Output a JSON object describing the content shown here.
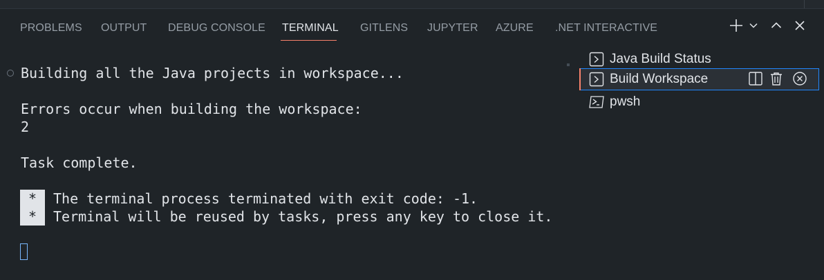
{
  "panel": {
    "tabs": [
      {
        "label": "PROBLEMS"
      },
      {
        "label": "OUTPUT"
      },
      {
        "label": "DEBUG CONSOLE"
      },
      {
        "label": "TERMINAL",
        "active": true
      },
      {
        "label": "GITLENS"
      },
      {
        "label": "JUPYTER"
      },
      {
        "label": "AZURE"
      },
      {
        "label": ".NET INTERACTIVE"
      }
    ],
    "actions": {
      "new_terminal": "plus-icon",
      "dropdown": "chevron-down-icon",
      "maximize": "chevron-up-icon",
      "close": "close-icon"
    }
  },
  "terminal": {
    "lines": [
      "Building all the Java projects in workspace...",
      "Errors occur when building the workspace:",
      "2",
      "Task complete.",
      "The terminal process terminated with exit code: -1.",
      "Terminal will be reused by tasks, press any key to close it."
    ],
    "star": "*"
  },
  "terminal_list": {
    "items": [
      {
        "label": "Java Build Status",
        "icon": "task-terminal-icon"
      },
      {
        "label": "Build Workspace",
        "icon": "task-terminal-icon",
        "selected": true
      },
      {
        "label": "pwsh",
        "icon": "powershell-icon"
      }
    ],
    "inline_actions": [
      "split-icon",
      "trash-icon",
      "circle-close-icon"
    ]
  },
  "colors": {
    "background": "#1f2428",
    "text": "#e1e4e8",
    "muted": "#959da5",
    "active_underline": "#f9826c",
    "focus": "#2188ff"
  }
}
